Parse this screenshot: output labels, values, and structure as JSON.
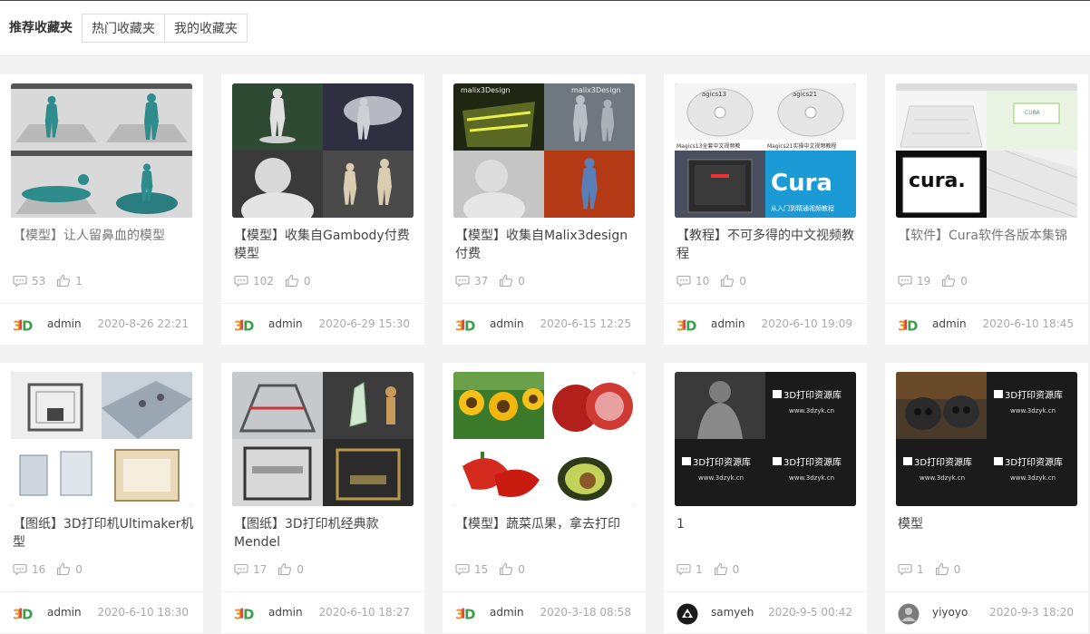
{
  "tabs": [
    {
      "label": "推荐收藏夹",
      "active": true
    },
    {
      "label": "热门收藏夹",
      "active": false
    },
    {
      "label": "我的收藏夹",
      "active": false
    }
  ],
  "cards": [
    {
      "title": "【模型】让人留鼻血的模型",
      "comments": "53",
      "likes": "1",
      "user": "admin",
      "date": "2020-8-26 22:21",
      "avatar": "3d-logo",
      "thumb": "teal-figures"
    },
    {
      "title": "【模型】收集自Gambody付费模型",
      "comments": "102",
      "likes": "0",
      "user": "admin",
      "date": "2020-6-29 15:30",
      "avatar": "3d-logo",
      "thumb": "gambody"
    },
    {
      "title": "【模型】收集自Malix3design付费",
      "comments": "37",
      "likes": "0",
      "user": "admin",
      "date": "2020-6-15 12:25",
      "avatar": "3d-logo",
      "thumb": "malix3d",
      "thumb_text": "malix3Design"
    },
    {
      "title": "【教程】不可多得的中文视频教程",
      "comments": "10",
      "likes": "0",
      "user": "admin",
      "date": "2020-6-10 19:09",
      "avatar": "3d-logo",
      "thumb": "cura-tutorial",
      "thumb_text": "Cura",
      "thumb_sub": "从入门到精通视频教程",
      "disc1": "agics13",
      "disc2": "agics21",
      "caption1": "Magics13全套中文视频教",
      "caption2": "Magics21实操中文视频教程"
    },
    {
      "title": "【软件】Cura软件各版本集锦",
      "comments": "19",
      "likes": "0",
      "user": "admin",
      "date": "2020-6-10 18:45",
      "avatar": "3d-logo",
      "thumb": "cura-software",
      "thumb_text": "cura."
    },
    {
      "title": "【图纸】3D打印机Ultimaker机型",
      "comments": "16",
      "likes": "0",
      "user": "admin",
      "date": "2020-6-10 18:30",
      "avatar": "3d-logo",
      "thumb": "ultimaker"
    },
    {
      "title": "【图纸】3D打印机经典款Mendel",
      "comments": "17",
      "likes": "0",
      "user": "admin",
      "date": "2020-6-10 18:27",
      "avatar": "3d-logo",
      "thumb": "mendel"
    },
    {
      "title": "【模型】蔬菜瓜果，拿去打印",
      "comments": "15",
      "likes": "0",
      "user": "admin",
      "date": "2020-3-18 08:58",
      "avatar": "3d-logo",
      "thumb": "veggies"
    },
    {
      "title": "1",
      "comments": "1",
      "likes": "0",
      "user": "samyeh",
      "date": "2020-9-5 00:42",
      "avatar": "samyeh",
      "thumb": "3dzyk-dark",
      "thumb_text": "3D打印资源库",
      "thumb_sub": "www.3dzyk.cn"
    },
    {
      "title": "模型",
      "comments": "1",
      "likes": "0",
      "user": "yiyoyo",
      "date": "2020-9-3 18:20",
      "avatar": "yiyoyo",
      "thumb": "3dzyk-skulls",
      "thumb_text": "3D打印资源库",
      "thumb_sub": "www.3dzyk.cn"
    }
  ],
  "colors": {
    "logo_orange": "#e8912d",
    "logo_green": "#3aa14a",
    "logo_red": "#d94a3b",
    "cura_blue": "#1b9ad6"
  }
}
